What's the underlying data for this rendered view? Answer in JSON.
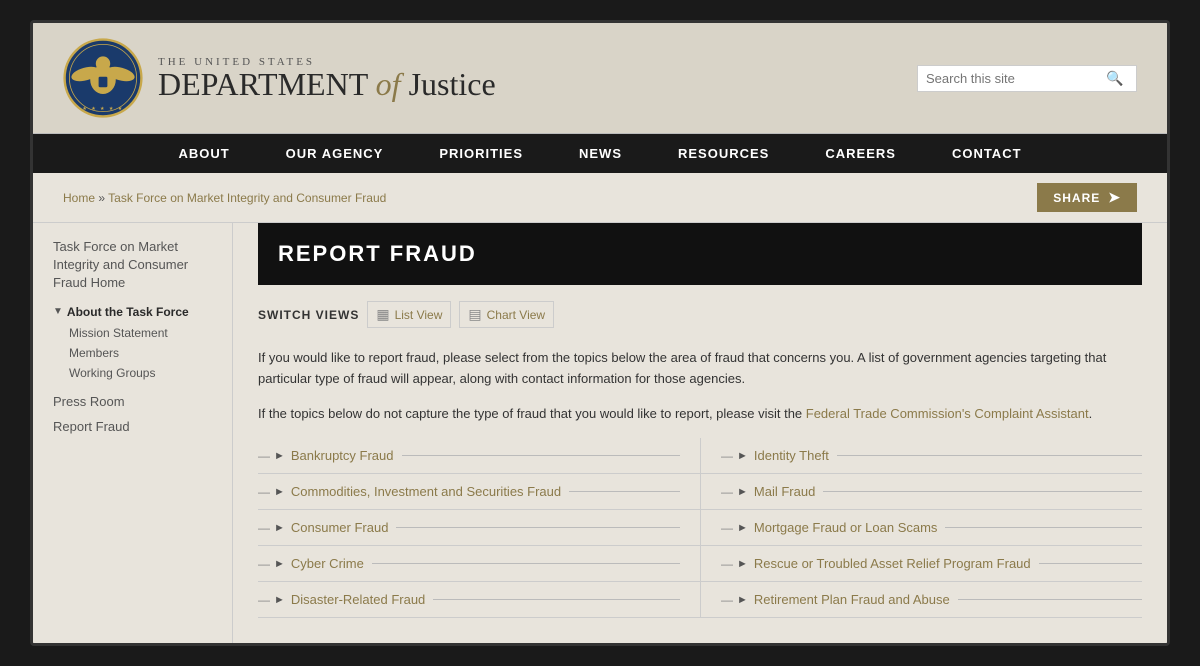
{
  "header": {
    "title_top": "THE UNITED STATES",
    "title_main_part1": "DEPARTMENT",
    "title_main_of": "of",
    "title_main_part2": "Justice",
    "search_placeholder": "Search this site"
  },
  "nav": {
    "items": [
      {
        "label": "ABOUT"
      },
      {
        "label": "OUR AGENCY"
      },
      {
        "label": "PRIORITIES"
      },
      {
        "label": "NEWS"
      },
      {
        "label": "RESOURCES"
      },
      {
        "label": "CAREERS"
      },
      {
        "label": "CONTACT"
      }
    ]
  },
  "breadcrumb": {
    "home": "Home",
    "separator": "»",
    "current": "Task Force on Market Integrity and Consumer Fraud"
  },
  "share_button": "SHARE",
  "sidebar": {
    "home_link": "Task Force on Market Integrity and Consumer Fraud Home",
    "about_section": "About the Task Force",
    "sub_items": [
      "Mission Statement",
      "Members",
      "Working Groups"
    ],
    "links": [
      "Press Room",
      "Report Fraud"
    ]
  },
  "page_title": "REPORT FRAUD",
  "view_switcher": {
    "label": "SWITCH VIEWS",
    "list_view": "List View",
    "chart_view": "Chart View"
  },
  "intro": {
    "para1": "If you would like to report fraud, please select from the topics below the area of fraud that concerns you.  A list of government agencies targeting that particular type of fraud will appear, along with contact information for those agencies.",
    "para2_before": "If the topics below do not capture the type of fraud that you would like to report, please visit the ",
    "para2_link": "Federal Trade Commission's Complaint Assistant",
    "para2_after": "."
  },
  "fraud_items_left": [
    "Bankruptcy Fraud",
    "Commodities, Investment and Securities Fraud",
    "Consumer Fraud",
    "Cyber Crime",
    "Disaster-Related Fraud"
  ],
  "fraud_items_right": [
    "Identity Theft",
    "Mail Fraud",
    "Mortgage Fraud or Loan Scams",
    "Rescue or Troubled Asset Relief Program Fraud",
    "Retirement Plan Fraud and Abuse"
  ]
}
